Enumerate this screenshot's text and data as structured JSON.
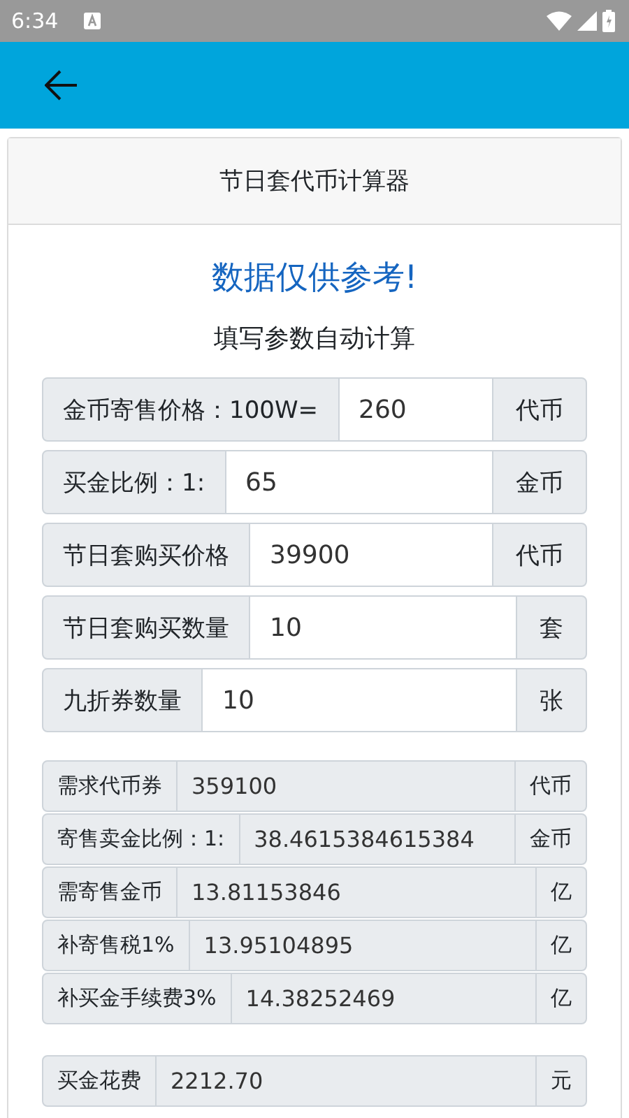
{
  "status_bar": {
    "time": "6:34"
  },
  "card": {
    "title": "节日套代币计算器",
    "notice": "数据仅供参考!",
    "subtitle": "填写参数自动计算",
    "params": [
      {
        "label": "金币寄售价格：100W=",
        "value": "260",
        "unit": "代币"
      },
      {
        "label": "买金比例：1:",
        "value": "65",
        "unit": "金币"
      },
      {
        "label": "节日套购买价格",
        "value": "39900",
        "unit": "代币"
      },
      {
        "label": "节日套购买数量",
        "value": "10",
        "unit": "套"
      },
      {
        "label": "九折券数量",
        "value": "10",
        "unit": "张"
      }
    ],
    "result_groups": [
      [
        {
          "label": "需求代币券",
          "value": "359100",
          "unit": "代币"
        },
        {
          "label": "寄售卖金比例：1:",
          "value": "38.4615384615384",
          "unit": "金币"
        },
        {
          "label": "需寄售金币",
          "value": "13.81153846",
          "unit": "亿"
        },
        {
          "label": "补寄售税1%",
          "value": "13.95104895",
          "unit": "亿"
        },
        {
          "label": "补买金手续费3%",
          "value": "14.38252469",
          "unit": "亿"
        }
      ],
      [
        {
          "label": "买金花费",
          "value": "2212.70",
          "unit": "元"
        }
      ]
    ]
  }
}
